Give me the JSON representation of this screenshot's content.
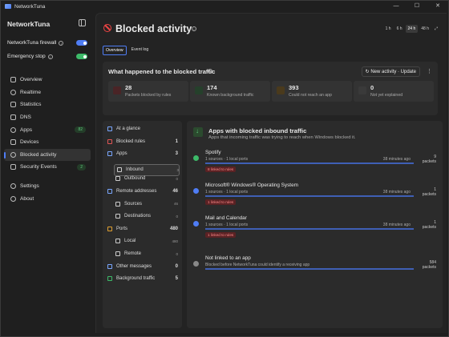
{
  "window": {
    "title": "NetworkTuna",
    "controls": [
      "—",
      "☐",
      "✕"
    ]
  },
  "sidebar": {
    "app_name": "NetworkTuna",
    "firewall_label": "NetworkTuna firewall",
    "estop_label": "Emergency stop",
    "nav": [
      {
        "label": "Overview"
      },
      {
        "label": "Realtime"
      },
      {
        "label": "Statistics"
      },
      {
        "label": "DNS"
      },
      {
        "label": "Apps",
        "badge": "82"
      },
      {
        "label": "Devices"
      },
      {
        "label": "Blocked activity",
        "active": true
      },
      {
        "label": "Security Events",
        "badge": "2"
      },
      {
        "label": "Settings"
      },
      {
        "label": "About"
      }
    ]
  },
  "header": {
    "title": "Blocked activity",
    "ranges": [
      "1 h",
      "6 h",
      "24 h",
      "48 h"
    ],
    "selected_range": "24 h"
  },
  "tabs": [
    {
      "label": "Overview",
      "selected": true
    },
    {
      "label": "Event log"
    }
  ],
  "summary": {
    "title": "What happened to the blocked traffic",
    "new_activity": "New activity · Update",
    "stats": [
      {
        "num": "28",
        "label": "Packets blocked by rules",
        "color": "#e05555"
      },
      {
        "num": "174",
        "label": "Known background traffic",
        "color": "#3dba69"
      },
      {
        "num": "393",
        "label": "Could not reach an app",
        "color": "#e0a030"
      },
      {
        "num": "0",
        "label": "Not yet explained",
        "color": "#cccccc"
      }
    ]
  },
  "left_list": [
    {
      "label": "At a glance",
      "count": "",
      "color": "#7aa7ff"
    },
    {
      "label": "Blocked rules",
      "count": "1",
      "color": "#e05555"
    },
    {
      "label": "Apps",
      "count": "3",
      "color": "#7aa7ff"
    },
    {
      "label": "Inbound",
      "count": "3",
      "color": "#cccccc",
      "sub": true,
      "selected": true
    },
    {
      "label": "Outbound",
      "count": "0",
      "color": "#cccccc",
      "sub": true
    },
    {
      "label": "Remote addresses",
      "count": "46",
      "color": "#7aa7ff"
    },
    {
      "label": "Sources",
      "count": "46",
      "color": "#cccccc",
      "sub": true
    },
    {
      "label": "Destinations",
      "count": "0",
      "color": "#cccccc",
      "sub": true
    },
    {
      "label": "Ports",
      "count": "480",
      "color": "#e0a030"
    },
    {
      "label": "Local",
      "count": "480",
      "color": "#cccccc",
      "sub": true
    },
    {
      "label": "Remote",
      "count": "0",
      "color": "#cccccc",
      "sub": true
    },
    {
      "label": "Other messages",
      "count": "0",
      "color": "#7aa7ff"
    },
    {
      "label": "Background traffic",
      "count": "5",
      "color": "#3dba69"
    }
  ],
  "inbound": {
    "title": "Apps with blocked inbound traffic",
    "subtitle": "Apps that incoming traffic was trying to reach when Windows blocked it.",
    "apps": [
      {
        "name": "Spotify",
        "meta": "1 sources · 1 local ports",
        "ago": "38 minutes ago",
        "packets": "9",
        "packets_label": "packets",
        "tag": "8 linked to rules",
        "icon_color": "#3dba69"
      },
      {
        "name": "Microsoft® Windows® Operating System",
        "meta": "1 sources · 1 local ports",
        "ago": "38 minutes ago",
        "packets": "1",
        "packets_label": "packets",
        "tag": "1 linked to rules",
        "icon_color": "#4f7df5"
      },
      {
        "name": "Mail and Calendar",
        "meta": "1 sources · 1 local ports",
        "ago": "38 minutes ago",
        "packets": "1",
        "packets_label": "packets",
        "tag": "1 linked to rules",
        "icon_color": "#4f7df5"
      },
      {
        "name": "Not linked to an app",
        "meta": "Blocked before NetworkTuna could identify a receiving app",
        "ago": "",
        "packets": "584",
        "packets_label": "packets",
        "tag": "",
        "icon_color": "#888888"
      }
    ]
  }
}
